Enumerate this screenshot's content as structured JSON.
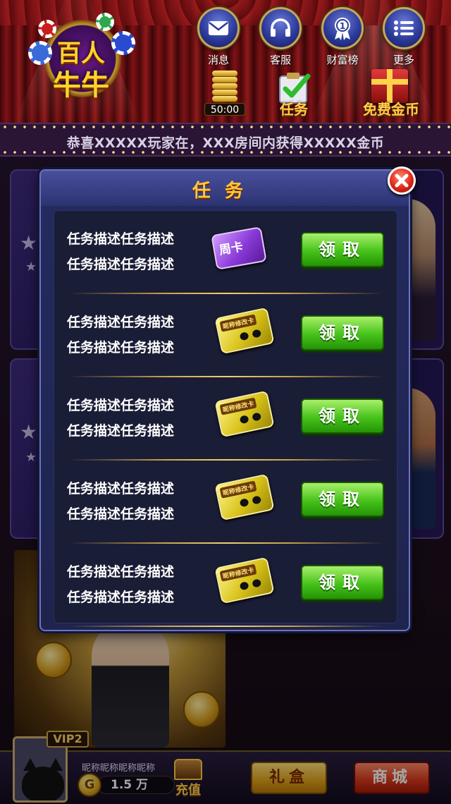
{
  "header": {
    "logo_line1": "百人",
    "logo_line2": "牛牛",
    "nav": [
      {
        "label": "消息",
        "icon": "mail-icon"
      },
      {
        "label": "客服",
        "icon": "headset-icon"
      },
      {
        "label": "财富榜",
        "icon": "rank-medal-icon"
      },
      {
        "label": "更多",
        "icon": "list-icon"
      }
    ],
    "timer": "50:00",
    "task_label": "任务",
    "free_coins_label": "免费金币"
  },
  "marquee": {
    "message": "恭喜XXXXX玩家在，XXX房间内获得XXXXX金币"
  },
  "dialog": {
    "title": "任务",
    "tasks": [
      {
        "line1": "任务描述任务描述",
        "line2": "任务描述任务描述",
        "reward": "周卡",
        "reward_type": "weekly-card",
        "button": "领取"
      },
      {
        "line1": "任务描述任务描述",
        "line2": "任务描述任务描述",
        "reward": "昵称修改卡",
        "reward_type": "rename-card",
        "button": "领取"
      },
      {
        "line1": "任务描述任务描述",
        "line2": "任务描述任务描述",
        "reward": "昵称修改卡",
        "reward_type": "rename-card",
        "button": "领取"
      },
      {
        "line1": "任务描述任务描述",
        "line2": "任务描述任务描述",
        "reward": "昵称修改卡",
        "reward_type": "rename-card",
        "button": "领取"
      },
      {
        "line1": "任务描述任务描述",
        "line2": "任务描述任务描述",
        "reward": "昵称修改卡",
        "reward_type": "rename-card",
        "button": "领取"
      }
    ]
  },
  "footer": {
    "vip": "VIP2",
    "nickname": "昵称昵称昵称昵称",
    "coin_symbol": "G",
    "balance": "1.5 万",
    "recharge_label": "充值",
    "gift_label": "礼盒",
    "shop_label": "商城"
  },
  "colors": {
    "accent_gold": "#ffc83a",
    "claim_green": "#46c21a",
    "dialog_bg": "#1f244e",
    "close_red": "#e0261a"
  }
}
